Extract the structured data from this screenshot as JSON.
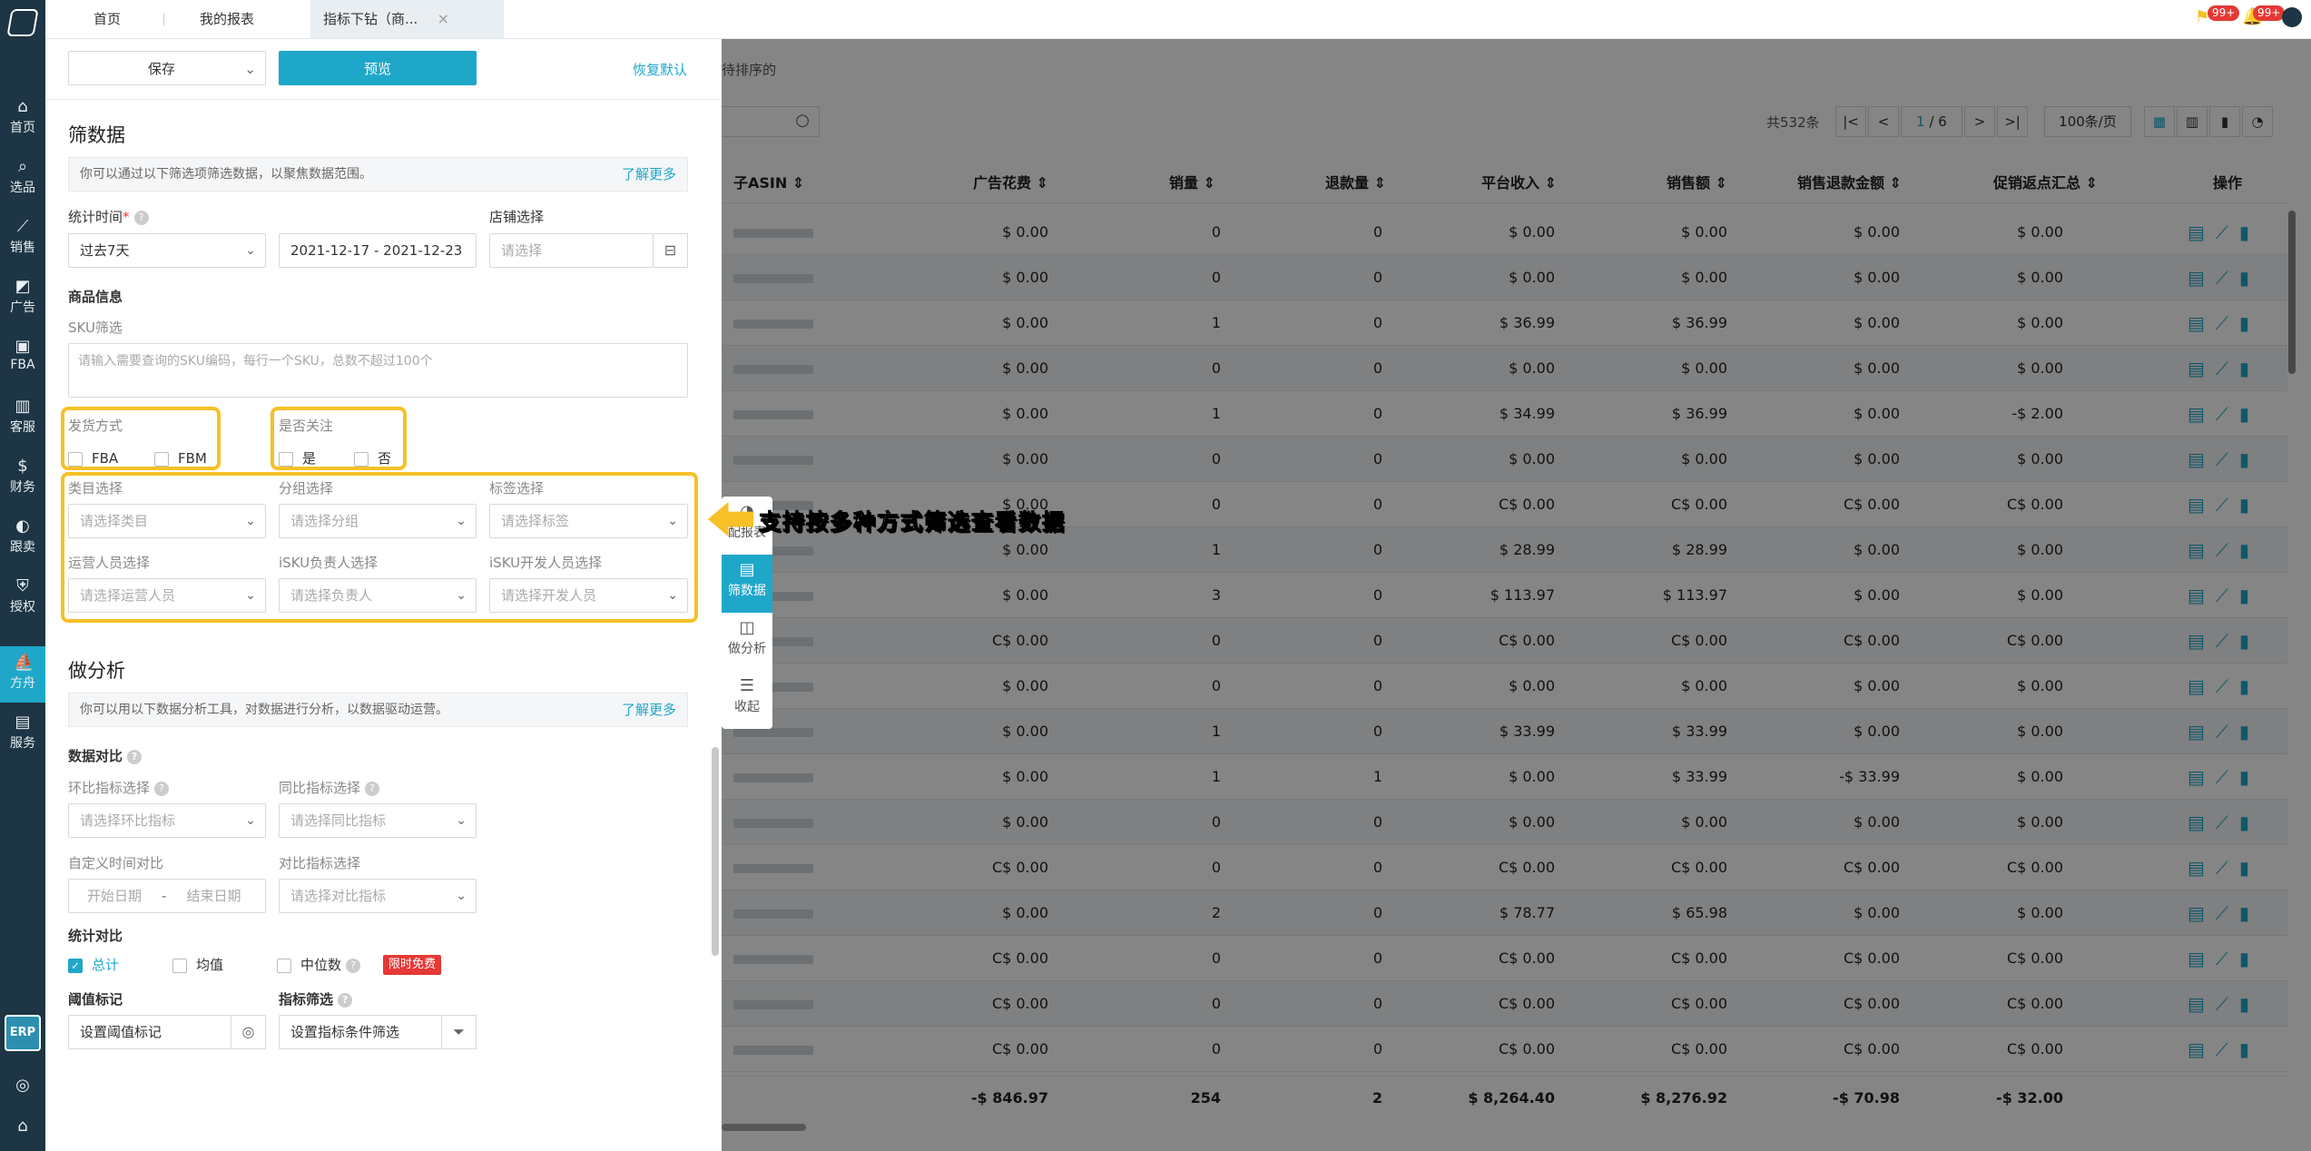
{
  "tabs": [
    {
      "label": "首页"
    },
    {
      "label": "我的报表"
    },
    {
      "label": "指标下钻（商..."
    }
  ],
  "topbar": {
    "flag_badge": "99+",
    "bell_badge": "99+"
  },
  "sidebar": {
    "items": [
      {
        "label": "首页",
        "icon": "home-icon"
      },
      {
        "label": "选品",
        "icon": "search-icon"
      },
      {
        "label": "销售",
        "icon": "chart-icon"
      },
      {
        "label": "广告",
        "icon": "ad-icon"
      },
      {
        "label": "FBA",
        "icon": "box-icon"
      },
      {
        "label": "客服",
        "icon": "service-icon"
      },
      {
        "label": "财务",
        "icon": "money-icon"
      },
      {
        "label": "跟卖",
        "icon": "follow-icon"
      },
      {
        "label": "授权",
        "icon": "shield-icon"
      },
      {
        "label": "方舟",
        "icon": "ark-icon"
      },
      {
        "label": "服务",
        "icon": "service-bag-icon"
      }
    ],
    "active_index": 9,
    "erp_label": "ERP"
  },
  "panel": {
    "save_label": "保存",
    "preview_label": "预览",
    "reset_label": "恢复默认",
    "filter": {
      "title": "筛数据",
      "hint": "你可以通过以下筛选项筛选数据，以聚焦数据范围。",
      "learn_more": "了解更多",
      "time_label": "统计时间",
      "time_required": "*",
      "time_range_value": "过去7天",
      "date_start": "2021-12-17",
      "date_sep": "-",
      "date_end": "2021-12-23",
      "shop_label": "店铺选择",
      "shop_placeholder": "请选择",
      "product_info_label": "商品信息",
      "sku_label": "SKU筛选",
      "sku_placeholder": "请输入需要查询的SKU编码，每行一个SKU，总数不超过100个",
      "ship_label": "发货方式",
      "ship_options": [
        "FBA",
        "FBM"
      ],
      "follow_label": "是否关注",
      "follow_options": [
        "是",
        "否"
      ],
      "category_label": "类目选择",
      "category_placeholder": "请选择类目",
      "group_label": "分组选择",
      "group_placeholder": "请选择分组",
      "tag_label": "标签选择",
      "tag_placeholder": "请选择标签",
      "operator_label": "运营人员选择",
      "operator_placeholder": "请选择运营人员",
      "isku_owner_label": "iSKU负责人选择",
      "isku_owner_placeholder": "请选择负责人",
      "isku_dev_label": "iSKU开发人员选择",
      "isku_dev_placeholder": "请选择开发人员"
    },
    "analysis": {
      "title": "做分析",
      "hint": "你可以用以下数据分析工具，对数据进行分析，以数据驱动运营。",
      "learn_more": "了解更多",
      "compare_label": "数据对比",
      "mom_label": "环比指标选择",
      "mom_placeholder": "请选择环比指标",
      "yoy_label": "同比指标选择",
      "yoy_placeholder": "请选择同比指标",
      "custom_time_label": "自定义时间对比",
      "start_placeholder": "开始日期",
      "range_sep": "-",
      "end_placeholder": "结束日期",
      "contrast_label": "对比指标选择",
      "contrast_placeholder": "请选择对比指标",
      "stat_label": "统计对比",
      "stat_total": "总计",
      "stat_mean": "均值",
      "stat_median": "中位数",
      "free_tag": "限时免费",
      "threshold_label": "阈值标记",
      "threshold_placeholder": "设置阈值标记",
      "metric_filter_label": "指标筛选",
      "metric_filter_placeholder": "设置指标条件筛选"
    }
  },
  "float_nav": {
    "items": [
      {
        "label": "配报表",
        "icon": "report-icon"
      },
      {
        "label": "筛数据",
        "icon": "filter-data-icon"
      },
      {
        "label": "做分析",
        "icon": "analysis-icon"
      },
      {
        "label": "收起",
        "icon": "collapse-icon"
      }
    ],
    "active_index": 1
  },
  "callout": {
    "text": "支持按多种方式筛选查看数据"
  },
  "table": {
    "toolbar_text": "待排序的",
    "total_text": "共532条",
    "page_current": "1",
    "page_total": "/ 6",
    "page_size": "100条/页",
    "columns": [
      "子ASIN",
      "广告花费",
      "销量",
      "退款量",
      "平台收入",
      "销售额",
      "销售退款金额",
      "促销返点汇总",
      "操作"
    ],
    "rows": [
      [
        "$ 0.00",
        "0",
        "0",
        "$ 0.00",
        "$ 0.00",
        "$ 0.00",
        "$ 0.00"
      ],
      [
        "$ 0.00",
        "0",
        "0",
        "$ 0.00",
        "$ 0.00",
        "$ 0.00",
        "$ 0.00"
      ],
      [
        "$ 0.00",
        "1",
        "0",
        "$ 36.99",
        "$ 36.99",
        "$ 0.00",
        "$ 0.00"
      ],
      [
        "$ 0.00",
        "0",
        "0",
        "$ 0.00",
        "$ 0.00",
        "$ 0.00",
        "$ 0.00"
      ],
      [
        "$ 0.00",
        "1",
        "0",
        "$ 34.99",
        "$ 36.99",
        "$ 0.00",
        "-$ 2.00"
      ],
      [
        "$ 0.00",
        "0",
        "0",
        "$ 0.00",
        "$ 0.00",
        "$ 0.00",
        "$ 0.00"
      ],
      [
        "$ 0.00",
        "0",
        "0",
        "C$ 0.00",
        "C$ 0.00",
        "C$ 0.00",
        "C$ 0.00"
      ],
      [
        "$ 0.00",
        "1",
        "0",
        "$ 28.99",
        "$ 28.99",
        "$ 0.00",
        "$ 0.00"
      ],
      [
        "$ 0.00",
        "3",
        "0",
        "$ 113.97",
        "$ 113.97",
        "$ 0.00",
        "$ 0.00"
      ],
      [
        "C$ 0.00",
        "0",
        "0",
        "C$ 0.00",
        "C$ 0.00",
        "C$ 0.00",
        "C$ 0.00"
      ],
      [
        "$ 0.00",
        "0",
        "0",
        "$ 0.00",
        "$ 0.00",
        "$ 0.00",
        "$ 0.00"
      ],
      [
        "$ 0.00",
        "1",
        "0",
        "$ 33.99",
        "$ 33.99",
        "$ 0.00",
        "$ 0.00"
      ],
      [
        "$ 0.00",
        "1",
        "1",
        "$ 0.00",
        "$ 33.99",
        "-$ 33.99",
        "$ 0.00"
      ],
      [
        "$ 0.00",
        "0",
        "0",
        "$ 0.00",
        "$ 0.00",
        "$ 0.00",
        "$ 0.00"
      ],
      [
        "C$ 0.00",
        "0",
        "0",
        "C$ 0.00",
        "C$ 0.00",
        "C$ 0.00",
        "C$ 0.00"
      ],
      [
        "$ 0.00",
        "2",
        "0",
        "$ 78.77",
        "$ 65.98",
        "$ 0.00",
        "$ 0.00"
      ],
      [
        "C$ 0.00",
        "0",
        "0",
        "C$ 0.00",
        "C$ 0.00",
        "C$ 0.00",
        "C$ 0.00"
      ],
      [
        "C$ 0.00",
        "0",
        "0",
        "C$ 0.00",
        "C$ 0.00",
        "C$ 0.00",
        "C$ 0.00"
      ],
      [
        "C$ 0.00",
        "0",
        "0",
        "C$ 0.00",
        "C$ 0.00",
        "C$ 0.00",
        "C$ 0.00"
      ]
    ],
    "totals": [
      "-$ 846.97",
      "254",
      "2",
      "$ 8,264.40",
      "$ 8,276.92",
      "-$ 70.98",
      "-$ 32.00"
    ]
  }
}
